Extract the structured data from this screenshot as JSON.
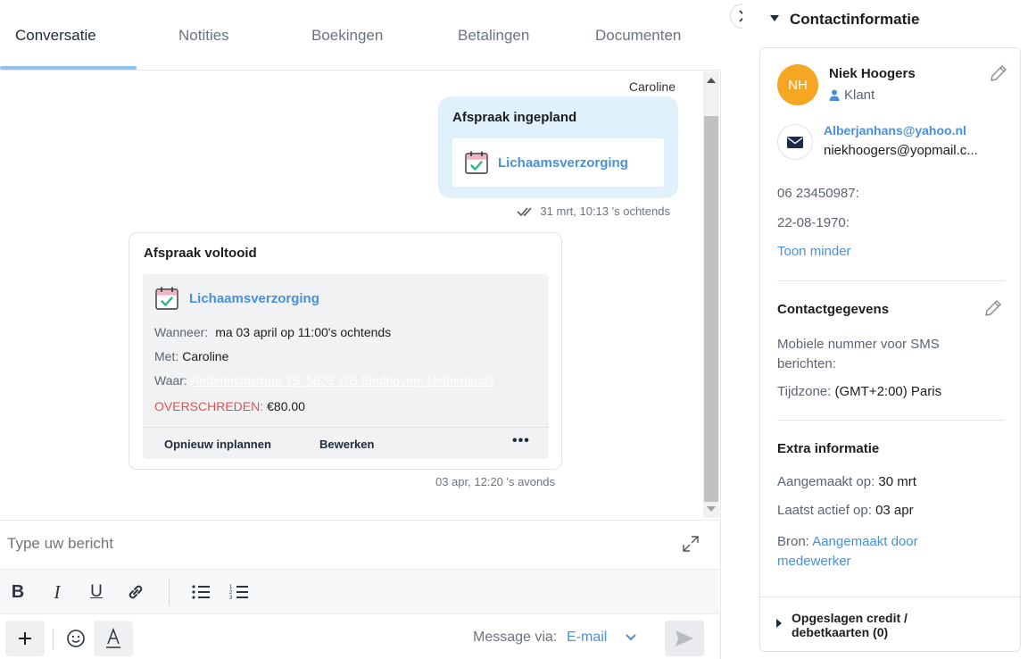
{
  "tabs": [
    {
      "label": "Conversatie"
    },
    {
      "label": "Notities"
    },
    {
      "label": "Boekingen"
    },
    {
      "label": "Betalingen"
    },
    {
      "label": "Documenten"
    }
  ],
  "conversation": {
    "msg1": {
      "sender": "Caroline",
      "title": "Afspraak ingepland",
      "service": "Lichaamsverzorging",
      "timestamp": "31 mrt, 10:13 's ochtends"
    },
    "msg2": {
      "title": "Afspraak voltooid",
      "service": "Lichaamsverzorging",
      "when_label": "Wanneer:",
      "when_value": "ma 03 april op 11:00's ochtends",
      "with_label": "Met:",
      "with_value": "Caroline",
      "where_label": "Waar:",
      "where_value": "Anderlechtstraat 15, 5628 WB Eindhoven, Netherlands",
      "status_label": "OVERSCHREDEN:",
      "amount": "€80.00",
      "action_reschedule": "Opnieuw inplannen",
      "action_edit": "Bewerken",
      "more": "•••",
      "timestamp": "03 apr, 12:20 's avonds"
    }
  },
  "composer": {
    "placeholder": "Type uw bericht",
    "message_via_label": "Message via:",
    "message_via_value": "E-mail"
  },
  "contact": {
    "section_title": "Contactinformatie",
    "initials": "NH",
    "name": "Niek Hoogers",
    "role": "Klant",
    "email_primary": "Alberjanhans@yahoo.nl",
    "email_secondary": "niekhoogers@yopmail.c...",
    "phone": "06 23450987:",
    "birthdate": "22-08-1970:",
    "toggle": "Toon minder",
    "details_title": "Contactgegevens",
    "sms_label": "Mobiele nummer voor SMS berichten:",
    "timezone_label": "Tijdzone:",
    "timezone_value": "(GMT+2:00) Paris",
    "extra_title": "Extra informatie",
    "created_label": "Aangemaakt op:",
    "created_value": "30 mrt",
    "last_active_label": "Laatst actief op:",
    "last_active_value": "03 apr",
    "source_label": "Bron:",
    "source_value": "Aangemaakt door medewerker",
    "saved_cards": "Opgeslagen credit / debetkaarten (0)"
  },
  "colors": {
    "accent": "#4a90d9",
    "avatar": "#f5a623",
    "bubble": "#e1f1fc",
    "overdue": "#e05252",
    "tab_underline": "#8ec4ef"
  }
}
